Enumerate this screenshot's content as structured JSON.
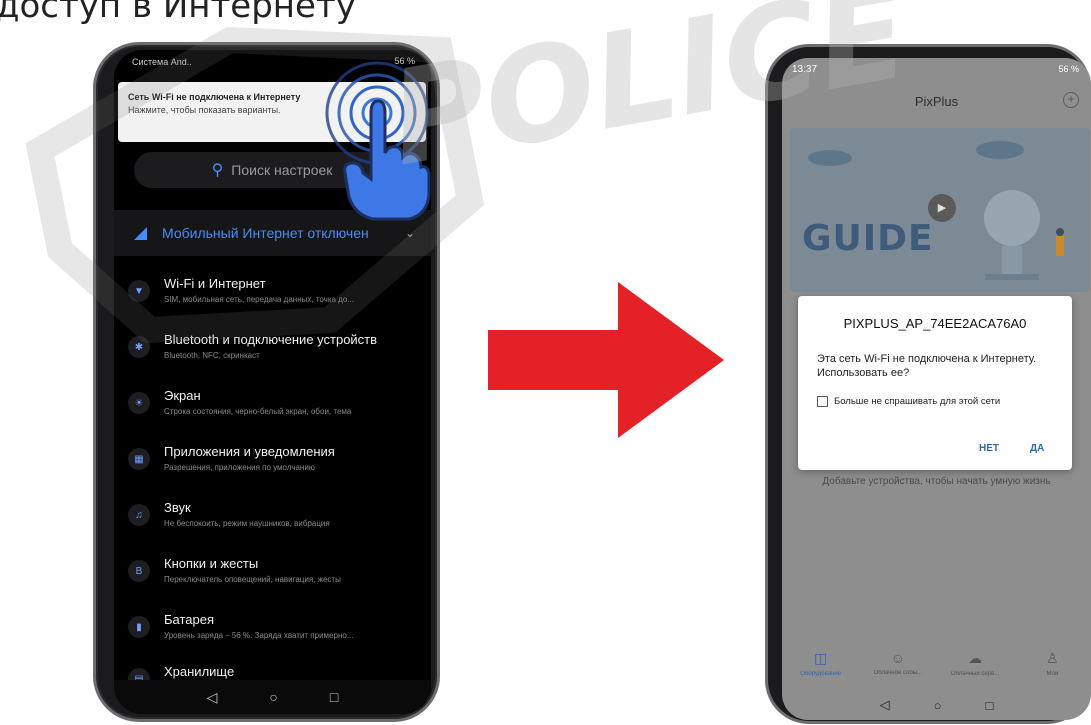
{
  "caption": "доступ в Интернету",
  "watermark": "POLICE",
  "left_phone": {
    "status_bar": {
      "carrier": "Система And..",
      "right": "56 %"
    },
    "notification": {
      "title": "Сеть Wi-Fi не подключена к Интернету",
      "subtitle": "Нажмите, чтобы показать варианты."
    },
    "search": {
      "placeholder": "Поиск настроек"
    },
    "banner": {
      "label": "Мобильный Интернет отключен"
    },
    "items": [
      {
        "title": "Wi-Fi и Интернет",
        "subtitle": "SIM, мобильная сеть, передача данных, точка до...",
        "icon": "wifi-icon"
      },
      {
        "title": "Bluetooth и подключение устройств",
        "subtitle": "Bluetooth, NFC, скринкаст",
        "icon": "bluetooth-icon"
      },
      {
        "title": "Экран",
        "subtitle": "Строка состояния, черно-белый экран, обои, тема",
        "icon": "brightness-icon"
      },
      {
        "title": "Приложения и уведомления",
        "subtitle": "Разрешения, приложения по умолчанию",
        "icon": "apps-icon"
      },
      {
        "title": "Звук",
        "subtitle": "Не беспокоить, режим наушников, вибрация",
        "icon": "sound-icon"
      },
      {
        "title": "Кнопки и жесты",
        "subtitle": "Переключатель оповещений, навигация, жесты",
        "icon": "buttons-icon"
      },
      {
        "title": "Батарея",
        "subtitle": "Уровень заряда – 56 %. Заряда хватит примерно...",
        "icon": "battery-icon"
      },
      {
        "title": "Хранилище",
        "subtitle": "",
        "icon": "storage-icon"
      }
    ]
  },
  "right_phone": {
    "status_bar": {
      "time": "13:37",
      "right": "56 %"
    },
    "app_title": "PixPlus",
    "guide_label": "GUIDE",
    "hint": "Добавьте устройства, чтобы начать умную жизнь",
    "dialog": {
      "title": "PIXPLUS_AP_74EE2ACA76A0",
      "message": "Эта сеть Wi-Fi не подключена к Интернету. Использовать ее?",
      "checkbox": "Больше не спрашивать для этой сети",
      "no": "НЕТ",
      "yes": "ДА"
    },
    "tabs": [
      {
        "label": "Оборудование",
        "icon": "devices-icon",
        "active": true
      },
      {
        "label": "Облачное собы...",
        "icon": "events-icon",
        "active": false
      },
      {
        "label": "Облачный серв...",
        "icon": "cloud-icon",
        "active": false
      },
      {
        "label": "Мой",
        "icon": "profile-icon",
        "active": false
      }
    ]
  },
  "colors": {
    "arrow": "#e32126",
    "accent": "#4a8cf7",
    "dialog_button": "#2e6ab3"
  }
}
